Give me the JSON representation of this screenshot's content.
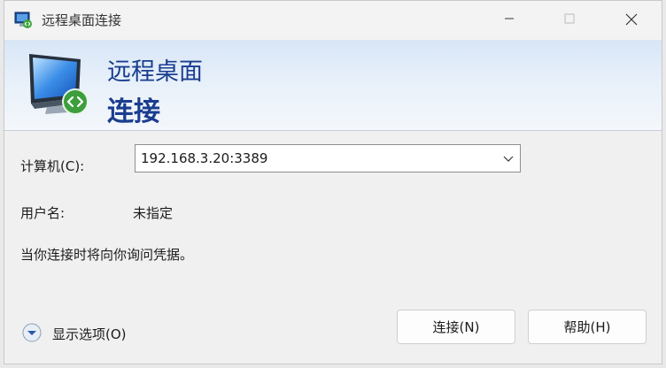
{
  "window": {
    "title": "远程桌面连接",
    "icons": {
      "app": "remote-desktop-icon",
      "minimize": "minimize-icon",
      "maximize": "maximize-icon",
      "close": "close-icon"
    }
  },
  "banner": {
    "line1": "远程桌面",
    "line2": "连接",
    "icon": "remote-desktop-monitor-icon"
  },
  "form": {
    "computer_label": "计算机(C):",
    "computer_value": "192.168.3.20:3389",
    "username_label": "用户名:",
    "username_value": "未指定",
    "info_text": "当你连接时将向你询问凭据。"
  },
  "footer": {
    "options_label": "显示选项(O)",
    "connect_label": "连接(N)",
    "help_label": "帮助(H)"
  },
  "colors": {
    "accent_text": "#1a3d8f",
    "banner_top": "#d8e6f6",
    "window_bg": "#f0f0f0"
  }
}
